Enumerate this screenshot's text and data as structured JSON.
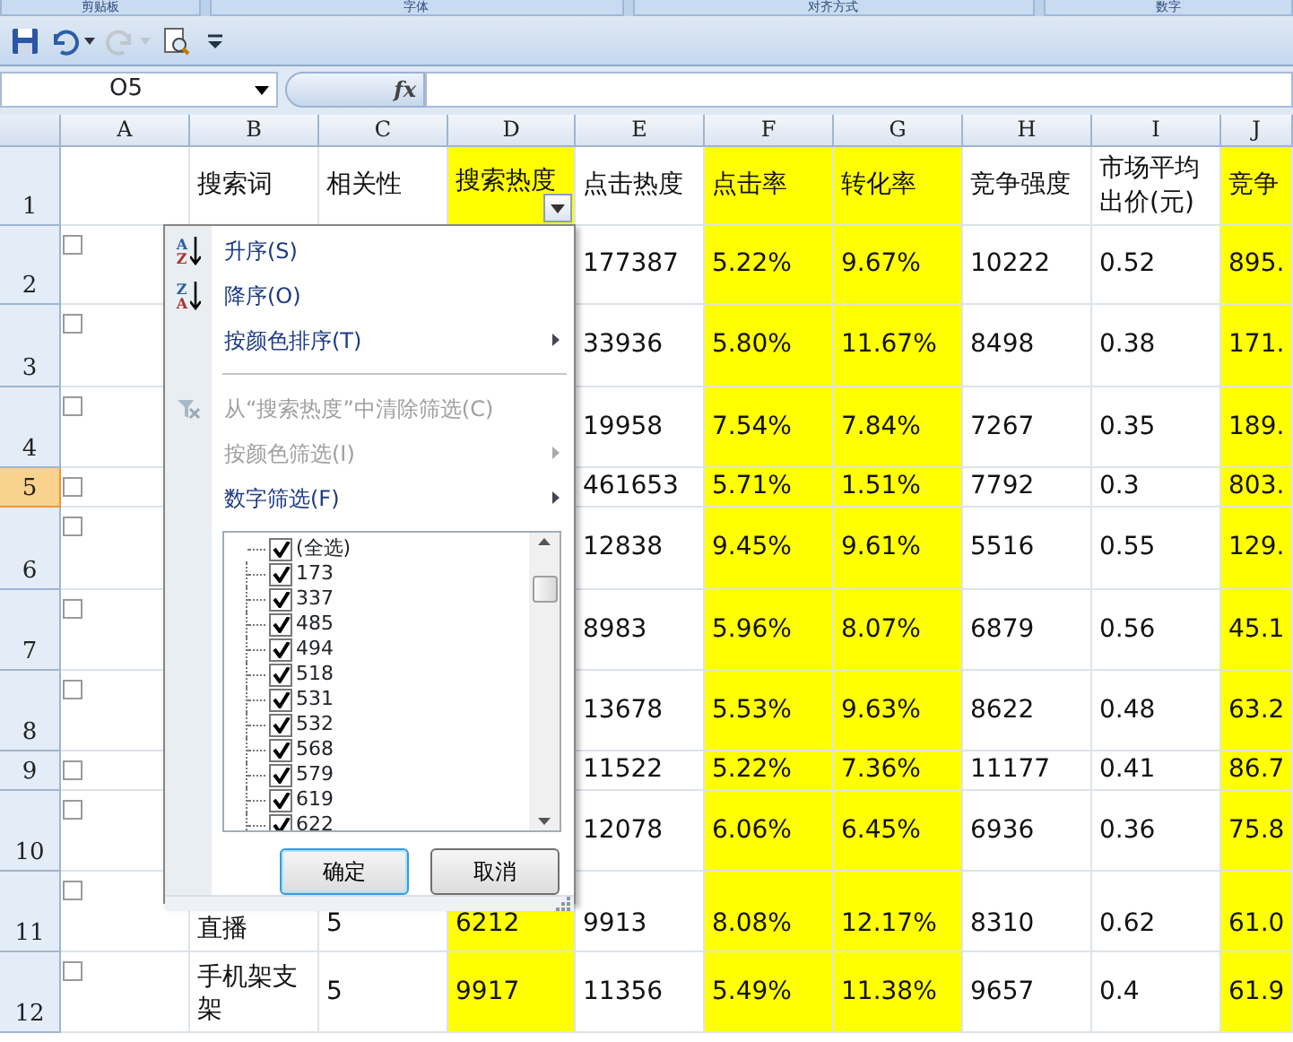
{
  "ribbon_groups": [
    "剪贴板",
    "字体",
    "对齐方式",
    "数字"
  ],
  "quick_access": [
    {
      "kind": "save",
      "disabled": false
    },
    {
      "kind": "undo",
      "disabled": false
    },
    {
      "kind": "redo",
      "disabled": true
    },
    {
      "kind": "print_preview",
      "disabled": false
    },
    {
      "kind": "customize",
      "disabled": false
    }
  ],
  "name_box": "O5",
  "formula_label": "fx",
  "columns": [
    {
      "letter": "A",
      "highlighted": false,
      "filter_button": false
    },
    {
      "letter": "B",
      "highlighted": false,
      "filter_button": false
    },
    {
      "letter": "C",
      "highlighted": false,
      "filter_button": false
    },
    {
      "letter": "D",
      "highlighted": true,
      "filter_button": true
    },
    {
      "letter": "E",
      "highlighted": false,
      "filter_button": false
    },
    {
      "letter": "F",
      "highlighted": true,
      "filter_button": false
    },
    {
      "letter": "G",
      "highlighted": true,
      "filter_button": false
    },
    {
      "letter": "H",
      "highlighted": false,
      "filter_button": false
    },
    {
      "letter": "I",
      "highlighted": false,
      "filter_button": false
    },
    {
      "letter": "J",
      "highlighted": true,
      "filter_button": false
    }
  ],
  "rows": [
    {
      "number": "1",
      "selected": false,
      "checkbox": null,
      "cells": {
        "B": "搜索词",
        "C": "相关性",
        "D": "搜索热度",
        "E": "点击热度",
        "F": "点击率",
        "G": "转化率",
        "H": "竞争强度",
        "I": "市场平均出价(元)",
        "J": "竞争"
      }
    },
    {
      "number": "2",
      "selected": false,
      "checkbox": {
        "checked": false
      },
      "cells": {
        "E": "177387",
        "F": "5.22%",
        "G": "9.67%",
        "H": "10222",
        "I": "0.52",
        "J": "895."
      }
    },
    {
      "number": "3",
      "selected": false,
      "checkbox": {
        "checked": false
      },
      "cells": {
        "E": "33936",
        "F": "5.80%",
        "G": "11.67%",
        "H": "8498",
        "I": "0.38",
        "J": "171."
      }
    },
    {
      "number": "4",
      "selected": false,
      "checkbox": {
        "checked": false
      },
      "cells": {
        "E": "19958",
        "F": "7.54%",
        "G": "7.84%",
        "H": "7267",
        "I": "0.35",
        "J": "189."
      }
    },
    {
      "number": "5",
      "selected": true,
      "checkbox": {
        "checked": false
      },
      "cells": {
        "E": "461653",
        "F": "5.71%",
        "G": "1.51%",
        "H": "7792",
        "I": "0.3",
        "J": "803."
      }
    },
    {
      "number": "6",
      "selected": false,
      "checkbox": {
        "checked": false
      },
      "cells": {
        "E": "12838",
        "F": "9.45%",
        "G": "9.61%",
        "H": "5516",
        "I": "0.55",
        "J": "129."
      }
    },
    {
      "number": "7",
      "selected": false,
      "checkbox": {
        "checked": false
      },
      "cells": {
        "E": "8983",
        "F": "5.96%",
        "G": "8.07%",
        "H": "6879",
        "I": "0.56",
        "J": "45.1"
      }
    },
    {
      "number": "8",
      "selected": false,
      "checkbox": {
        "checked": false
      },
      "cells": {
        "E": "13678",
        "F": "5.53%",
        "G": "9.63%",
        "H": "8622",
        "I": "0.48",
        "J": "63.2"
      }
    },
    {
      "number": "9",
      "selected": false,
      "checkbox": {
        "checked": false
      },
      "cells": {
        "E": "11522",
        "F": "5.22%",
        "G": "7.36%",
        "H": "11177",
        "I": "0.41",
        "J": "86.7"
      }
    },
    {
      "number": "10",
      "selected": false,
      "checkbox": {
        "checked": false
      },
      "cells": {
        "E": "12078",
        "F": "6.06%",
        "G": "6.45%",
        "H": "6936",
        "I": "0.36",
        "J": "75.8"
      }
    },
    {
      "number": "11",
      "selected": false,
      "checkbox": {
        "checked": false
      },
      "cells": {
        "B": "直播",
        "C": "5",
        "D": "6212",
        "E": "9913",
        "F": "8.08%",
        "G": "12.17%",
        "H": "8310",
        "I": "0.62",
        "J": "61.0"
      }
    },
    {
      "number": "12",
      "selected": false,
      "checkbox": {
        "checked": false
      },
      "cells": {
        "B": "手机架支架",
        "C": "5",
        "D": "9917",
        "E": "11356",
        "F": "5.49%",
        "G": "11.38%",
        "H": "9657",
        "I": "0.4",
        "J": "61.9"
      }
    }
  ],
  "filter_menu": {
    "items": [
      {
        "kind": "sort",
        "label": "升序(S)",
        "icon_letters": [
          "A",
          "Z"
        ],
        "disabled": false,
        "submenu": false
      },
      {
        "kind": "sort",
        "label": "降序(O)",
        "icon_letters": [
          "Z",
          "A"
        ],
        "disabled": false,
        "submenu": false
      },
      {
        "kind": "plain",
        "label": "按颜色排序(T)",
        "disabled": false,
        "submenu": true
      },
      {
        "kind": "separator"
      },
      {
        "kind": "clear_filter",
        "label": "从“搜索热度”中清除筛选(C)",
        "disabled": true,
        "submenu": false
      },
      {
        "kind": "plain",
        "label": "按颜色筛选(I)",
        "disabled": true,
        "submenu": true
      },
      {
        "kind": "plain",
        "label": "数字筛选(F)",
        "disabled": false,
        "submenu": true
      }
    ],
    "values": [
      {
        "label": "(全选)",
        "checked": true
      },
      {
        "label": "173",
        "checked": true
      },
      {
        "label": "337",
        "checked": true
      },
      {
        "label": "485",
        "checked": true
      },
      {
        "label": "494",
        "checked": true
      },
      {
        "label": "518",
        "checked": true
      },
      {
        "label": "531",
        "checked": true
      },
      {
        "label": "532",
        "checked": true
      },
      {
        "label": "568",
        "checked": true
      },
      {
        "label": "579",
        "checked": true
      },
      {
        "label": "619",
        "checked": true
      },
      {
        "label": "622",
        "checked": true
      }
    ],
    "buttons": [
      {
        "label": "确定",
        "default": true
      },
      {
        "label": "取消",
        "default": false
      }
    ]
  }
}
